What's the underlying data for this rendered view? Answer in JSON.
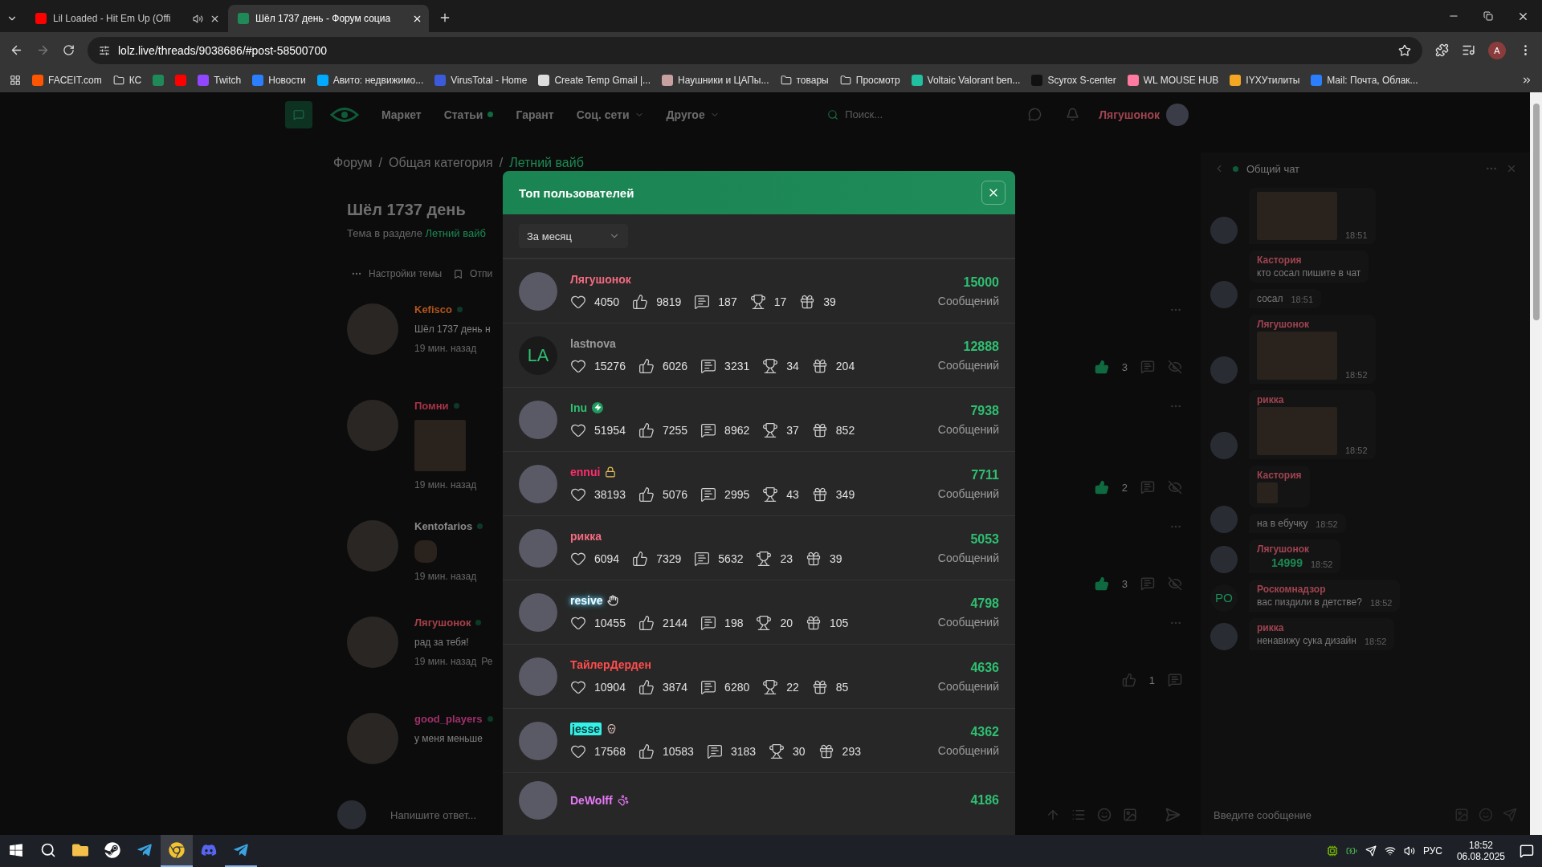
{
  "browser": {
    "tabs": [
      {
        "title": "Lil Loaded - Hit Em Up (Offi",
        "audio": true,
        "selected": false
      },
      {
        "title": "Шёл 1737 день - Форум социа",
        "audio": false,
        "selected": true
      }
    ],
    "url": "lolz.live/threads/9038686/#post-58500700",
    "profile_initial": "A",
    "bookmarks": [
      {
        "kind": "site",
        "label": "FACEIT.com",
        "color": "#ff5500"
      },
      {
        "kind": "folder",
        "label": "КС"
      },
      {
        "kind": "site",
        "color": "#1f8a58"
      },
      {
        "kind": "site",
        "color": "#ff0000"
      },
      {
        "kind": "site",
        "label": "Twitch",
        "color": "#9146ff"
      },
      {
        "kind": "site",
        "label": "Новости",
        "color": "#2b7fff"
      },
      {
        "kind": "site",
        "label": "Авито: недвижимо...",
        "color": "#00aaff"
      },
      {
        "kind": "site",
        "label": "VirusTotal - Home",
        "color": "#3b5bdb"
      },
      {
        "kind": "site",
        "label": "Create Temp Gmail |...",
        "color": "#dddddd"
      },
      {
        "kind": "site",
        "label": "Наушники и ЦАПы...",
        "color": "#c8a0a0"
      },
      {
        "kind": "folder",
        "label": "товары"
      },
      {
        "kind": "folder",
        "label": "Просмотр"
      },
      {
        "kind": "site",
        "label": "Voltaic Valorant ben...",
        "color": "#20c0a0"
      },
      {
        "kind": "site",
        "label": "Scyrox S-center",
        "color": "#111111"
      },
      {
        "kind": "site",
        "label": "WL MOUSE HUB",
        "color": "#ff7aa0"
      },
      {
        "kind": "site",
        "label": "IYXУтилиты",
        "color": "#f5a623"
      },
      {
        "kind": "site",
        "label": "Mail: Почта, Облак...",
        "color": "#2b7fff"
      }
    ]
  },
  "site": {
    "nav": [
      {
        "label": "Маркет",
        "dot": false,
        "menu": false
      },
      {
        "label": "Статьи",
        "dot": true,
        "menu": false
      },
      {
        "label": "Гарант",
        "dot": false,
        "menu": false
      },
      {
        "label": "Соц. сети",
        "dot": false,
        "menu": true
      },
      {
        "label": "Другое",
        "dot": false,
        "menu": true
      }
    ],
    "search_placeholder": "Поиск...",
    "username": "Лягушонок"
  },
  "breadcrumb": {
    "items": [
      "Форум",
      "Общая категория",
      "Летний вайб"
    ],
    "separator": "/"
  },
  "thread": {
    "title": "Шёл 1737 день",
    "subtitle": "Тема в разделе",
    "subtitle_link": "Летний вайб",
    "settings": "Настройки темы",
    "bookmark": "Отпи"
  },
  "posts": [
    {
      "name": "Kefisco",
      "color": "#b0561e",
      "kind": "text",
      "text": "Шёл 1737 день н",
      "time": "19 мин. назад",
      "likes": "3",
      "liked": true,
      "hide_icon": true
    },
    {
      "name": "Помни",
      "color": "#a83448",
      "kind": "image",
      "time": "19 мин. назад",
      "likes": "2",
      "liked": true,
      "hide_icon": true
    },
    {
      "name": "Kentofarios",
      "color": "#8a8a8a",
      "kind": "sticker",
      "time": "19 мин. назад",
      "likes": "3",
      "liked": true,
      "hide_icon": true
    },
    {
      "name": "Лягушонок",
      "color": "#a8404a",
      "kind": "text",
      "text": "рад за тебя!",
      "time": "19 мин. назад",
      "extra": "Ре",
      "likes": "1",
      "liked": false,
      "hide_icon": false
    },
    {
      "name": "good_players",
      "color": "#a0306a",
      "kind": "text",
      "text": "у меня меньше"
    }
  ],
  "reply_placeholder": "Напишите ответ...",
  "chat": {
    "title": "Общий чат",
    "input_placeholder": "Введите сообщение",
    "messages": [
      {
        "messages": [
          {
            "kind": "image",
            "time": "18:51"
          }
        ]
      },
      {
        "messages": [
          {
            "kind": "text",
            "name": "Кастория",
            "text": "кто сосал пишите в чат"
          },
          {
            "kind": "text",
            "text": "сосал",
            "time": "18:51"
          }
        ]
      },
      {
        "messages": [
          {
            "kind": "image",
            "name": "Лягушонок",
            "time": "18:52"
          }
        ]
      },
      {
        "messages": [
          {
            "kind": "image",
            "name": "рикка",
            "time": "18:52"
          }
        ]
      },
      {
        "messages": [
          {
            "kind": "sticker",
            "name": "Кастория"
          },
          {
            "kind": "text",
            "text": "на в ебучку",
            "time": "18:52"
          }
        ]
      },
      {
        "messages": [
          {
            "kind": "count",
            "name": "Лягушонок",
            "text": "14999",
            "time": "18:52"
          }
        ]
      },
      {
        "initials": "РО",
        "messages": [
          {
            "kind": "text",
            "name": "Роскомнадзор",
            "text": "вас пиздили в детстве?",
            "time": "18:52"
          }
        ]
      },
      {
        "messages": [
          {
            "kind": "text",
            "name": "рикка",
            "text": "ненавижу сука дизайн",
            "time": "18:52"
          }
        ]
      }
    ]
  },
  "modal": {
    "title": "Топ пользователей",
    "period": "За месяц",
    "rows": [
      {
        "name": "Лягушонок",
        "color": "#f36b7f",
        "kind": "plain",
        "stats": [
          "4050",
          "9819",
          "187",
          "17",
          "39"
        ],
        "count": "15000",
        "label": "Сообщений"
      },
      {
        "name": "lastnova",
        "color": "#9a9a9a",
        "kind": "plain",
        "initials": "LA",
        "stats": [
          "15276",
          "6026",
          "3231",
          "34",
          "204"
        ],
        "count": "12888",
        "label": "Сообщений"
      },
      {
        "name": "Inu",
        "color": "#2fbf71",
        "kind": "plain",
        "badge": {
          "kind": "bolt"
        },
        "stats": [
          "51954",
          "7255",
          "8962",
          "37",
          "852"
        ],
        "count": "7938",
        "label": "Сообщений"
      },
      {
        "name": "ennui",
        "color": "#ff2d6e",
        "kind": "plain",
        "badge": {
          "kind": "lock"
        },
        "stats": [
          "38193",
          "5076",
          "2995",
          "43",
          "349"
        ],
        "count": "7711",
        "label": "Сообщений"
      },
      {
        "name": "рикка",
        "color": "#f36b7f",
        "kind": "plain",
        "stats": [
          "6094",
          "7329",
          "5632",
          "23",
          "39"
        ],
        "count": "5053",
        "label": "Сообщений"
      },
      {
        "name": "resive",
        "color": "#f4fbff",
        "kind": "glow",
        "badge": {
          "kind": "hand"
        },
        "stats": [
          "10455",
          "2144",
          "198",
          "20",
          "105"
        ],
        "count": "4798",
        "label": "Сообщений"
      },
      {
        "name": "ТайлерДерден",
        "color": "#ff4d4d",
        "kind": "plain",
        "stats": [
          "10904",
          "3874",
          "6280",
          "22",
          "85"
        ],
        "count": "4636",
        "label": "Сообщений"
      },
      {
        "name": "jesse",
        "color": "#35f0e6",
        "kind": "highlight",
        "badge": {
          "kind": "skull"
        },
        "stats": [
          "17568",
          "10583",
          "3183",
          "30",
          "293"
        ],
        "count": "4362",
        "label": "Сообщений"
      },
      {
        "name": "DeWolff",
        "color": "#e879f9",
        "kind": "plain",
        "badge": {
          "kind": "paw"
        },
        "count": "4186"
      }
    ]
  },
  "taskbar": {
    "apps": [
      {
        "kind": "files",
        "selected": false,
        "running": false
      },
      {
        "kind": "steam",
        "selected": false,
        "running": false
      },
      {
        "kind": "telegram",
        "selected": false,
        "running": false
      },
      {
        "kind": "browser",
        "selected": true,
        "running": true
      },
      {
        "kind": "discord",
        "selected": false,
        "running": false
      },
      {
        "kind": "telegram",
        "selected": false,
        "running": true
      }
    ],
    "lang": "РУС",
    "time": "18:52",
    "date": "06.08.2025"
  }
}
